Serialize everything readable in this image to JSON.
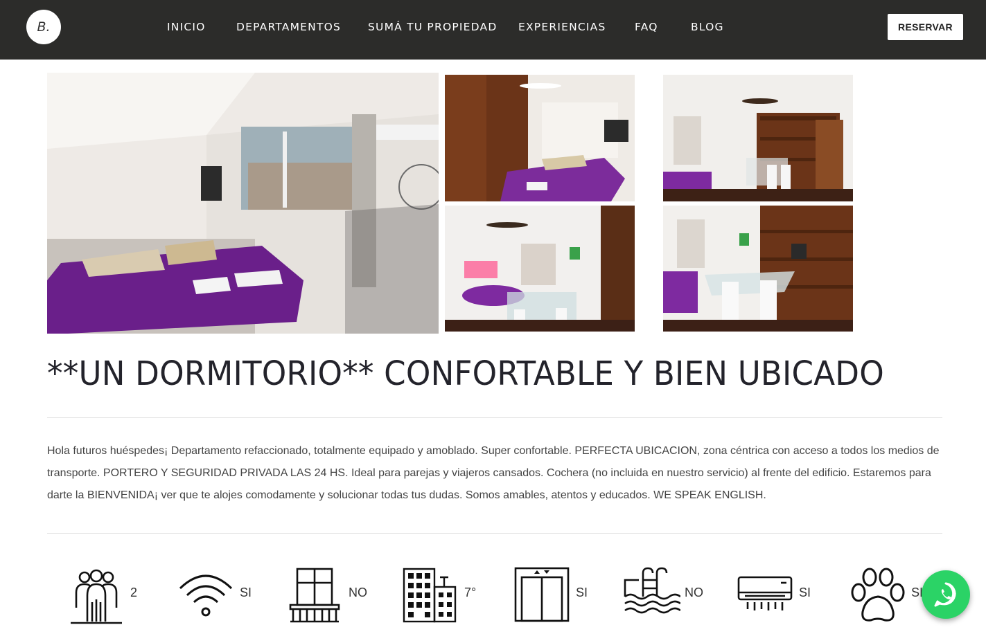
{
  "nav": {
    "logo_text": "B.",
    "links": [
      "INICIO",
      "DEPARTAMENTOS",
      "SUMÁ TU PROPIEDAD",
      "EXPERIENCIAS",
      "FAQ",
      "BLOG"
    ],
    "reserve_label": "RESERVAR"
  },
  "listing": {
    "title": "**UN DORMITORIO** CONFORTABLE Y BIEN UBICADO",
    "description": "Hola futuros huéspedes¡ Departamento refaccionado, totalmente equipado y amoblado. Super confortable. PERFECTA UBICACION, zona céntrica con acceso a todos los medios de transporte. PORTERO Y SEGURIDAD PRIVADA LAS 24 HS. Ideal para parejas y viajeros cansados. Cochera (no incluida en nuestro servicio) al frente del edificio. Estaremos para darte la BIENVENIDA¡ ver que te alojes comodamente y solucionar todas tus dudas. Somos amables, atentos y educados. WE SPEAK ENGLISH."
  },
  "amenities": [
    {
      "icon": "guests-icon",
      "value": "2"
    },
    {
      "icon": "wifi-icon",
      "value": "SI"
    },
    {
      "icon": "balcony-icon",
      "value": "NO"
    },
    {
      "icon": "building-floor-icon",
      "value": "7°"
    },
    {
      "icon": "elevator-icon",
      "value": "SI"
    },
    {
      "icon": "pool-icon",
      "value": "NO"
    },
    {
      "icon": "air-conditioning-icon",
      "value": "SI"
    },
    {
      "icon": "pets-icon",
      "value": "SI"
    }
  ],
  "colors": {
    "navbar": "#2c2c2a",
    "purple_bedspread": "#6a1f8a",
    "whatsapp": "#2bd366",
    "title": "#23232b"
  }
}
